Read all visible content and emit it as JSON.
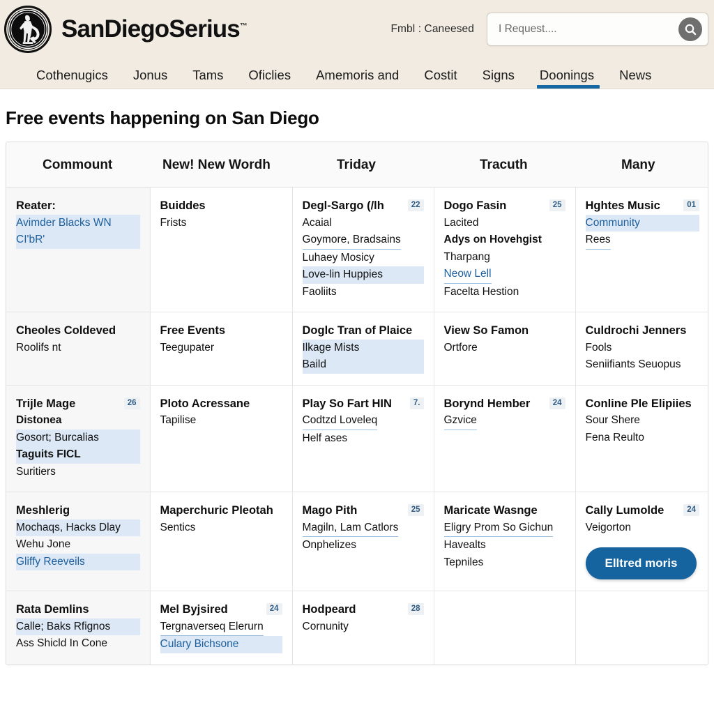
{
  "header": {
    "brand_name": "SanDiegoSerius",
    "brand_tm": "™",
    "tagline": "Fmbl :  Caneesed",
    "search_placeholder": "I Request....",
    "search_value": "",
    "search_icon": "search-icon",
    "logo_icon": "sandiego-emblem-icon"
  },
  "nav": {
    "items": [
      {
        "label": "Cothenugics",
        "active": false
      },
      {
        "label": "Jonus",
        "active": false
      },
      {
        "label": "Tams",
        "active": false
      },
      {
        "label": "Oficlies",
        "active": false
      },
      {
        "label": "Amemoris and",
        "active": false
      },
      {
        "label": "Costit",
        "active": false
      },
      {
        "label": "Signs",
        "active": false
      },
      {
        "label": "Doonings",
        "active": true
      },
      {
        "label": "News",
        "active": false
      }
    ],
    "active_underline_color": "#1668a5"
  },
  "page": {
    "title_bold": "Free",
    "title_rest": " events happening on San Diego"
  },
  "table": {
    "headers": [
      "Commount",
      "New! New Wordh",
      "Triday",
      "Tracuth",
      "Many"
    ],
    "rows": [
      {
        "cells": [
          {
            "title": "Reater:",
            "badge": "",
            "lines": [
              {
                "text": "Avimder Blacks WN",
                "style": "link hl"
              },
              {
                "text": "CI'bR'",
                "style": "link hl"
              }
            ]
          },
          {
            "title": "Buiddes",
            "badge": "",
            "lines": [
              {
                "text": "Frists",
                "style": ""
              }
            ]
          },
          {
            "title": "Degl-Sargo (/lh",
            "badge": "22",
            "lines": [
              {
                "text": "Acaial",
                "style": ""
              },
              {
                "text": "Goymore, Bradsains",
                "style": "ul"
              },
              {
                "text": "Luhaey Mosicy",
                "style": ""
              },
              {
                "text": "Love-lin Huppies",
                "style": "hl"
              },
              {
                "text": "Faoliits",
                "style": ""
              }
            ]
          },
          {
            "title": "Dogo Fasin",
            "badge": "25",
            "lines": [
              {
                "text": "Lacited",
                "style": ""
              },
              {
                "text": "Adys on Hovehgist",
                "style": "bold"
              },
              {
                "text": "Tharpang",
                "style": ""
              },
              {
                "text": "Neow Lell",
                "style": "link ul"
              },
              {
                "text": "Facelta Hestion",
                "style": ""
              }
            ]
          },
          {
            "title": "Hghtes Music",
            "badge": "01",
            "lines": [
              {
                "text": "Community",
                "style": "link hl"
              },
              {
                "text": "Rees",
                "style": "ul"
              }
            ]
          }
        ]
      },
      {
        "cells": [
          {
            "title": "Cheoles Coldeved",
            "badge": "",
            "lines": [
              {
                "text": "Roolifs nt",
                "style": ""
              }
            ]
          },
          {
            "title": "Free Events",
            "badge": "",
            "lines": [
              {
                "text": "Teegupater",
                "style": ""
              }
            ]
          },
          {
            "title": "Doglc Tran of Plaice",
            "badge": "",
            "lines": [
              {
                "text": "Ilkage Mists",
                "style": "hl"
              },
              {
                "text": "Baild",
                "style": "hl"
              }
            ]
          },
          {
            "title": "View So Famon",
            "badge": "",
            "lines": [
              {
                "text": "Ortfore",
                "style": ""
              }
            ]
          },
          {
            "title": "Culdrochi Jenners",
            "badge": "",
            "lines": [
              {
                "text": "Fools",
                "style": ""
              },
              {
                "text": "Seniifiants Seuopus",
                "style": ""
              }
            ]
          }
        ]
      },
      {
        "cells": [
          {
            "title": "Trijle Mage",
            "badge": "26",
            "lines": [
              {
                "text": "Distonea",
                "style": "bold"
              },
              {
                "text": "Gosort; Burcalias",
                "style": "hl"
              },
              {
                "text": "Taguits FICL",
                "style": "bold hl"
              },
              {
                "text": "Suritiers",
                "style": ""
              }
            ]
          },
          {
            "title": "Ploto Acressane",
            "badge": "",
            "lines": [
              {
                "text": "Tapilise",
                "style": ""
              }
            ]
          },
          {
            "title": "Play So Fart HIN",
            "badge": "7.",
            "lines": [
              {
                "text": "Codtzd Loveleq",
                "style": "ul"
              },
              {
                "text": "Helf ases",
                "style": ""
              }
            ]
          },
          {
            "title": "Borynd Hember",
            "badge": "24",
            "lines": [
              {
                "text": "Gzvice",
                "style": "ul"
              }
            ]
          },
          {
            "title": "Conline Ple Elipiies",
            "badge": "",
            "lines": [
              {
                "text": "Sour Shere",
                "style": ""
              },
              {
                "text": "Fena Reulto",
                "style": ""
              }
            ]
          }
        ]
      },
      {
        "cells": [
          {
            "title": "Meshlerig",
            "badge": "",
            "lines": [
              {
                "text": "Mochaqs, Hacks Dlay",
                "style": "hl"
              },
              {
                "text": "Wehu Jone",
                "style": ""
              },
              {
                "text": "Gliffy Reeveils",
                "style": "link hl"
              }
            ]
          },
          {
            "title": "Maperchuric Pleotah",
            "badge": "",
            "lines": [
              {
                "text": "Sentics",
                "style": ""
              }
            ]
          },
          {
            "title": "Mago Pith",
            "badge": "25",
            "lines": [
              {
                "text": "Magiln, Lam Catlors",
                "style": "ul"
              },
              {
                "text": "Onphelizes",
                "style": ""
              }
            ]
          },
          {
            "title": "Maricate Wasnge",
            "badge": "",
            "lines": [
              {
                "text": "Eligry Prom So Gichun",
                "style": "ul"
              },
              {
                "text": "Havealts",
                "style": ""
              },
              {
                "text": "Tepniles",
                "style": ""
              }
            ]
          },
          {
            "title": "Cally Lumolde",
            "badge": "24",
            "lines": [
              {
                "text": "Veigorton",
                "style": ""
              }
            ],
            "cta": "Elltred moris"
          }
        ]
      },
      {
        "cells": [
          {
            "title": "Rata Demlins",
            "badge": "",
            "lines": [
              {
                "text": "Calle; Baks Rfignos",
                "style": "hl"
              },
              {
                "text": "Ass Shicld In Cone",
                "style": ""
              }
            ]
          },
          {
            "title": "Mel Byjsired",
            "badge": "24",
            "lines": [
              {
                "text": "Tergnaverseq Elerurn",
                "style": "ul"
              },
              {
                "text": "Culary Bichsone",
                "style": "link hl"
              }
            ]
          },
          {
            "title": "Hodpeard",
            "badge": "28",
            "lines": [
              {
                "text": "Cornunity",
                "style": ""
              }
            ]
          },
          {
            "title": "",
            "badge": "",
            "lines": []
          },
          {
            "title": "",
            "badge": "",
            "lines": []
          }
        ]
      }
    ]
  },
  "colors": {
    "header_bg": "#f1ebe1",
    "accent_blue": "#1668a5",
    "cta_blue": "#15639f",
    "link_blue": "#1b5f9e",
    "highlight": "#dce8f5",
    "first_col_bg": "#f7f7f7"
  }
}
